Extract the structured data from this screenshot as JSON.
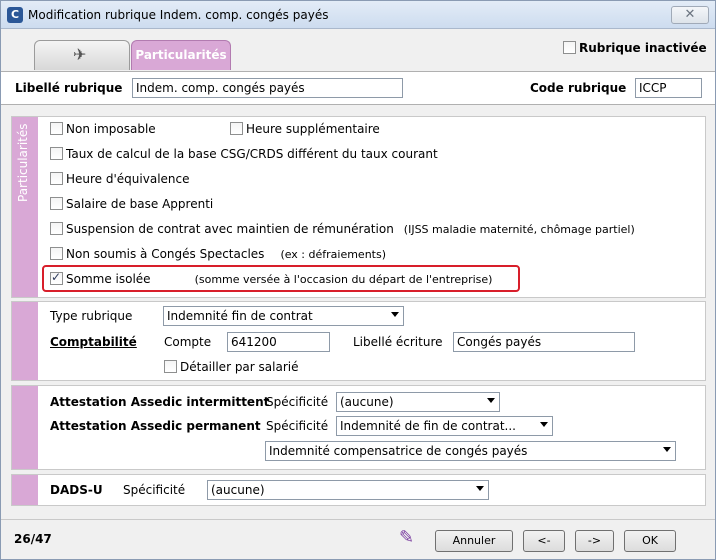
{
  "window": {
    "title": "Modification rubrique Indem. comp. congés payés",
    "close_icon": "close-icon"
  },
  "tabs": [
    {
      "label": "",
      "icon": "stamp-icon"
    },
    {
      "label": "Particularités",
      "active": true
    }
  ],
  "inactive": {
    "label": "Rubrique inactivée",
    "checked": false
  },
  "libelle": {
    "label": "Libellé rubrique",
    "value": "Indem. comp. congés payés"
  },
  "code": {
    "label": "Code rubrique",
    "value": "ICCP"
  },
  "particularites": {
    "side_label": "Particularités",
    "options": [
      {
        "label": "Non imposable",
        "checked": false
      },
      {
        "label": "Heure supplémentaire",
        "checked": false
      },
      {
        "label": "Taux de calcul de la base CSG/CRDS différent du taux courant",
        "checked": false
      },
      {
        "label": "Heure d'équivalence",
        "checked": false
      },
      {
        "label": "Salaire de base Apprenti",
        "checked": false
      },
      {
        "label": "Suspension de contrat avec maintien de rémunération",
        "note": "(IJSS maladie maternité, chômage partiel)",
        "checked": false
      },
      {
        "label": "Non soumis à Congés Spectacles",
        "note": "(ex : défraiements)",
        "checked": false
      },
      {
        "label": "Somme isolée",
        "note": "(somme versée à l'occasion du départ de l'entreprise)",
        "checked": true
      }
    ]
  },
  "type_rubrique": {
    "label": "Type rubrique",
    "value": "Indemnité fin de contrat"
  },
  "comptabilite": {
    "label": "Comptabilité",
    "compte_label": "Compte",
    "compte_value": "641200",
    "libelle_ecriture_label": "Libellé écriture",
    "libelle_ecriture_value": "Congés payés",
    "detailler_label": "Détailler par salarié",
    "detailler_checked": false
  },
  "assedic": {
    "intermittent_label": "Attestation Assedic intermittent",
    "permanent_label": "Attestation Assedic permanent",
    "specificite_label": "Spécificité",
    "intermittent_value": "(aucune)",
    "permanent_value": "Indemnité de fin de contrat...",
    "permanent_sub_value": "Indemnité compensatrice de congés payés"
  },
  "dadsu": {
    "label": "DADS-U",
    "specificite_label": "Spécificité",
    "value": "(aucune)"
  },
  "footer": {
    "counter": "26/47",
    "annuler": "Annuler",
    "prev": "<-",
    "next": "->",
    "ok": "OK"
  },
  "colors": {
    "accent": "#d9a8d6",
    "highlight": "#d81e2a"
  }
}
